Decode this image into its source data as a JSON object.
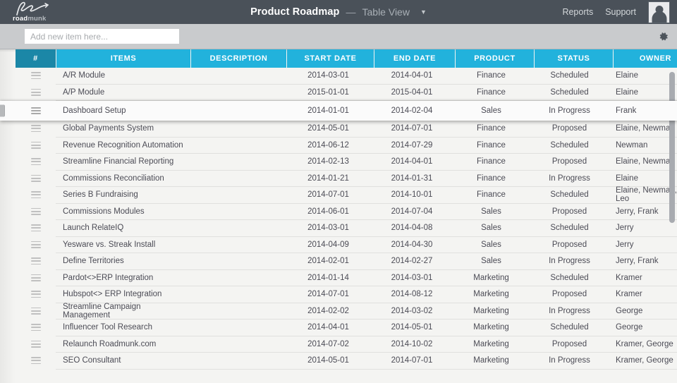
{
  "topbar": {
    "brand_bold": "road",
    "brand_light": "munk",
    "doc_title": "Product Roadmap",
    "title_dash": "—",
    "view_name": "Table View",
    "view_caret": "▼",
    "links": [
      {
        "label": "Reports"
      },
      {
        "label": "Support"
      }
    ],
    "avatar_name": "user-avatar"
  },
  "toolbar": {
    "add_placeholder": "Add new item here...",
    "add_value": "",
    "gear_label": "⚙"
  },
  "table": {
    "columns": [
      {
        "key": "num",
        "label": "#"
      },
      {
        "key": "item",
        "label": "ITEMS"
      },
      {
        "key": "desc",
        "label": "DESCRIPTION"
      },
      {
        "key": "start",
        "label": "START DATE"
      },
      {
        "key": "end",
        "label": "END DATE"
      },
      {
        "key": "prod",
        "label": "PRODUCT"
      },
      {
        "key": "stat",
        "label": "STATUS"
      },
      {
        "key": "own",
        "label": "OWNER"
      }
    ],
    "dragging_row": {
      "item": "Dashboard Setup",
      "desc": "",
      "start": "2014-01-01",
      "end": "2014-02-04",
      "prod": "Sales",
      "stat": "In Progress",
      "own": "Frank"
    },
    "rows_above": [
      {
        "item": "A/R Module",
        "desc": "",
        "start": "2014-03-01",
        "end": "2014-04-01",
        "prod": "Finance",
        "stat": "Scheduled",
        "own": "Elaine"
      },
      {
        "item": "A/P Module",
        "desc": "",
        "start": "2015-01-01",
        "end": "2015-04-01",
        "prod": "Finance",
        "stat": "Scheduled",
        "own": "Elaine"
      }
    ],
    "rows_below": [
      {
        "item": "Global Payments System",
        "desc": "",
        "start": "2014-05-01",
        "end": "2014-07-01",
        "prod": "Finance",
        "stat": "Proposed",
        "own": "Elaine, Newman"
      },
      {
        "item": "Revenue Recognition Automation",
        "desc": "",
        "start": "2014-06-12",
        "end": "2014-07-29",
        "prod": "Finance",
        "stat": "Scheduled",
        "own": "Newman"
      },
      {
        "item": "Streamline Financial Reporting",
        "desc": "",
        "start": "2014-02-13",
        "end": "2014-04-01",
        "prod": "Finance",
        "stat": "Proposed",
        "own": "Elaine, Newman"
      },
      {
        "item": "Commissions Reconciliation",
        "desc": "",
        "start": "2014-01-21",
        "end": "2014-01-31",
        "prod": "Finance",
        "stat": "In Progress",
        "own": "Elaine"
      },
      {
        "item": "Series B Fundraising",
        "desc": "",
        "start": "2014-07-01",
        "end": "2014-10-01",
        "prod": "Finance",
        "stat": "Scheduled",
        "own": "Elaine, Newman, Leo"
      },
      {
        "item": "Commissions Modules",
        "desc": "",
        "start": "2014-06-01",
        "end": "2014-07-04",
        "prod": "Sales",
        "stat": "Proposed",
        "own": "Jerry, Frank"
      },
      {
        "item": "Launch RelateIQ",
        "desc": "",
        "start": "2014-03-01",
        "end": "2014-04-08",
        "prod": "Sales",
        "stat": "Scheduled",
        "own": "Jerry"
      },
      {
        "item": "Yesware vs. Streak Install",
        "desc": "",
        "start": "2014-04-09",
        "end": "2014-04-30",
        "prod": "Sales",
        "stat": "Proposed",
        "own": "Jerry"
      },
      {
        "item": "Define Territories",
        "desc": "",
        "start": "2014-02-01",
        "end": "2014-02-27",
        "prod": "Sales",
        "stat": "In Progress",
        "own": "Jerry, Frank"
      },
      {
        "item": "Pardot<>ERP Integration",
        "desc": "",
        "start": "2014-01-14",
        "end": "2014-03-01",
        "prod": "Marketing",
        "stat": "Scheduled",
        "own": "Kramer"
      },
      {
        "item": "Hubspot<> ERP Integration",
        "desc": "",
        "start": "2014-07-01",
        "end": "2014-08-12",
        "prod": "Marketing",
        "stat": "Proposed",
        "own": "Kramer"
      },
      {
        "item": "Streamline Campaign Management",
        "desc": "",
        "start": "2014-02-02",
        "end": "2014-03-02",
        "prod": "Marketing",
        "stat": "In Progress",
        "own": "George"
      },
      {
        "item": "Influencer Tool Research",
        "desc": "",
        "start": "2014-04-01",
        "end": "2014-05-01",
        "prod": "Marketing",
        "stat": "Scheduled",
        "own": "George"
      },
      {
        "item": "Relaunch Roadmunk.com",
        "desc": "",
        "start": "2014-07-02",
        "end": "2014-10-02",
        "prod": "Marketing",
        "stat": "Proposed",
        "own": "Kramer, George"
      },
      {
        "item": "SEO Consultant",
        "desc": "",
        "start": "2014-05-01",
        "end": "2014-07-01",
        "prod": "Marketing",
        "stat": "In Progress",
        "own": "Kramer, George"
      }
    ]
  },
  "colors": {
    "header_accent": "#22b2dc",
    "header_num": "#1b87a7",
    "topbar_bg": "#4a5159",
    "toolbar_bg": "#c9cbcd"
  }
}
